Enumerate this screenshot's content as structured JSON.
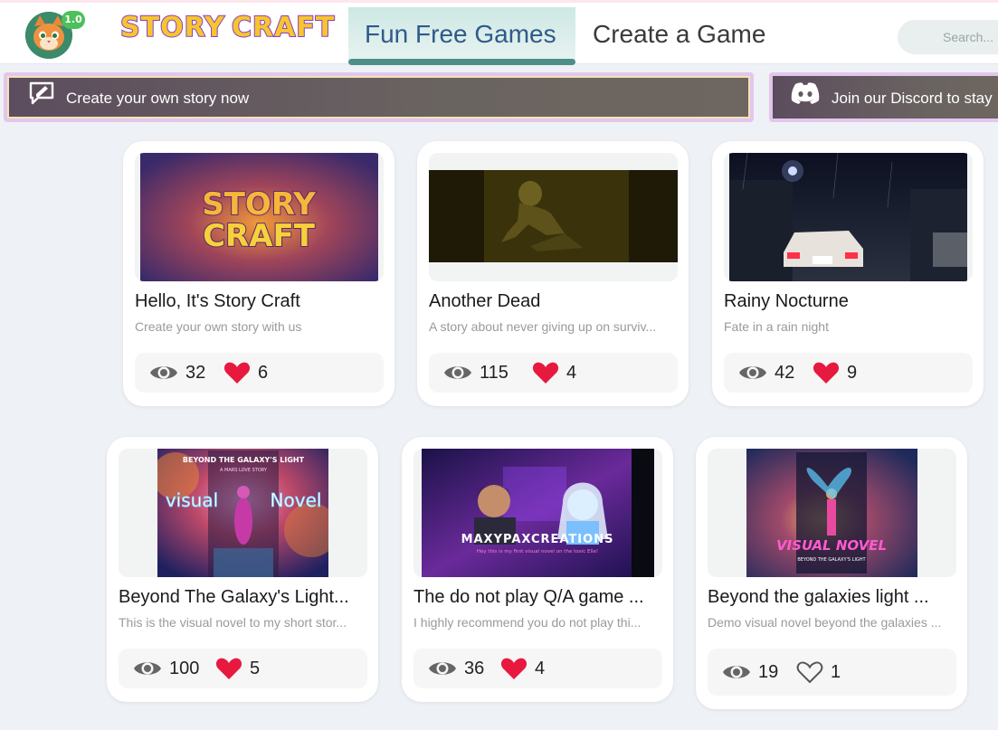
{
  "header": {
    "version": "1.0",
    "logo_story": "STORY",
    "logo_craft": "CRAFT",
    "tabs": [
      {
        "label": "Fun Free Games",
        "active": true
      },
      {
        "label": "Create a Game",
        "active": false
      }
    ],
    "search_placeholder": "Search..."
  },
  "banners": {
    "create": {
      "label": "Create your own story now",
      "icon": "edit-icon"
    },
    "discord": {
      "label": "Join our Discord to stay",
      "icon": "discord-icon"
    }
  },
  "colors": {
    "accent_teal": "#4f8f8a",
    "heart_red": "#e8193f",
    "badge_green": "#4cc05a"
  },
  "games": [
    {
      "title": "Hello, It's Story Craft",
      "description": "Create your own story with us",
      "views": "32",
      "likes": "6",
      "liked": true
    },
    {
      "title": "Another Dead",
      "description": "A story about never giving up on surviv...",
      "views": "115",
      "likes": "4",
      "liked": true
    },
    {
      "title": "Rainy Nocturne",
      "description": "Fate in a rain night",
      "views": "42",
      "likes": "9",
      "liked": true
    },
    {
      "title": "Beyond The Galaxy's Light...",
      "description": "This is the visual novel to my short stor...",
      "views": "100",
      "likes": "5",
      "liked": true
    },
    {
      "title": "The do not play Q/A game ...",
      "description": "I highly recommend you do not play thi...",
      "views": "36",
      "likes": "4",
      "liked": true
    },
    {
      "title": "Beyond the galaxies light ...",
      "description": "Demo visual novel beyond the galaxies ...",
      "views": "19",
      "likes": "1",
      "liked": false
    }
  ],
  "thumbnail_text": {
    "storycraft_line1": "STORY",
    "storycraft_line2": "CRAFT",
    "galaxy_top": "BEYOND THE GALAXY'S LIGHT",
    "galaxy_sub": "A MARS LOVE STORY",
    "galaxy_left": "visual",
    "galaxy_right": "Novel",
    "maxy": "MAXYPAXCREATIONS",
    "maxy_caption": "Hey this is my first visual novel on the toxic Elle!",
    "vn_title": "VISUAL NOVEL",
    "vn_sub": "BEYOND THE GALAXY'S LIGHT"
  }
}
